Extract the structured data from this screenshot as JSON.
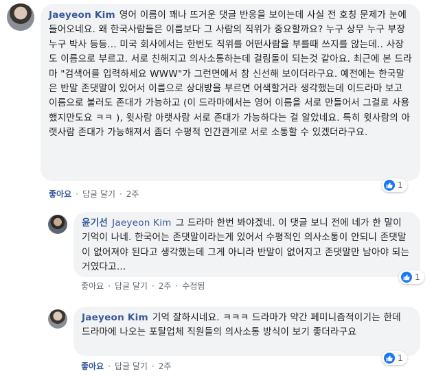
{
  "comments": [
    {
      "author": "Jaeyeon Kim",
      "text": "영어 이름이 꽤나 뜨거운 댓글 반응을 보이는데 사실 전 호칭 문제가 눈에 들어오네요. 왜 한국사람들은 이름보다 그 사람의 직위가 중요할까요? 누구 상무 누구 부장 누구 박사 등등... 미국 회사에서는 한번도 직위를 어떤사람을 부를때 쓰지를 않는데.. 사장도 이름으로 부르고. 서로 친해지고 의사소통하는데 걸림돌이 되는것 같아요. 최근에 본 드라마 \"검색어를 입력하세요 WWW\"가 그런면에서 참 신선해 보이더라구요. 예전에는 한국말은 반말 존댓말이 있어서 이름으로 상대방을 부르면 어색할거라 생각했는데 이드라마 보고 이름으로 불러도 존대가 가능하고 (이 드라마에서는 영어 이름을 서로 만들어서 그걸로 사용했지만도요 ㅋㅋ ), 윗사람 아랫사람 서로 존대가 가능하다는 걸 알았네요. 특히 윗사람의 아랫사람 존대가 가능해져서 좀더 수평적 인간관계로 서로 소통할 수 있겠더라구요.",
      "like_count": "1",
      "actions": {
        "like": "좋아요",
        "reply": "답글 달기",
        "time": "2주"
      }
    },
    {
      "author": "윤기선",
      "tag": "Jaeyeon Kim",
      "text": "그 드라마 한번 봐야겠네. 이 댓글 보니 전에 네가 한 말이 기억이 나네. 한국어는 존댓말이라는게 있어서 수평적인 의사소통이 안되니 존댓말이 없어져야 된다고 생각했는데 그게 아니라 반말이 없어지고 존댓말만 남아야 되는거였다고...",
      "like_count": "1",
      "actions": {
        "like": "좋아요",
        "reply": "답글 달기",
        "time": "2주",
        "edited": "수정됨"
      }
    },
    {
      "author": "Jaeyeon Kim",
      "text": "기억 잘하시네요. ㅋㅋㅋ 드라마가 약간 페미니즘적이기는 한데 드라마에 나오는 포탈업체 직원들의 의사소통 방식이 보기 좋더라구요",
      "like_count": "1",
      "actions": {
        "like": "좋아요",
        "reply": "답글 달기",
        "time": "2주"
      }
    }
  ],
  "separator": "·",
  "colors": {
    "link": "#385898",
    "bubble": "#f2f3f5",
    "like": "#1877f2",
    "meta": "#606770"
  }
}
